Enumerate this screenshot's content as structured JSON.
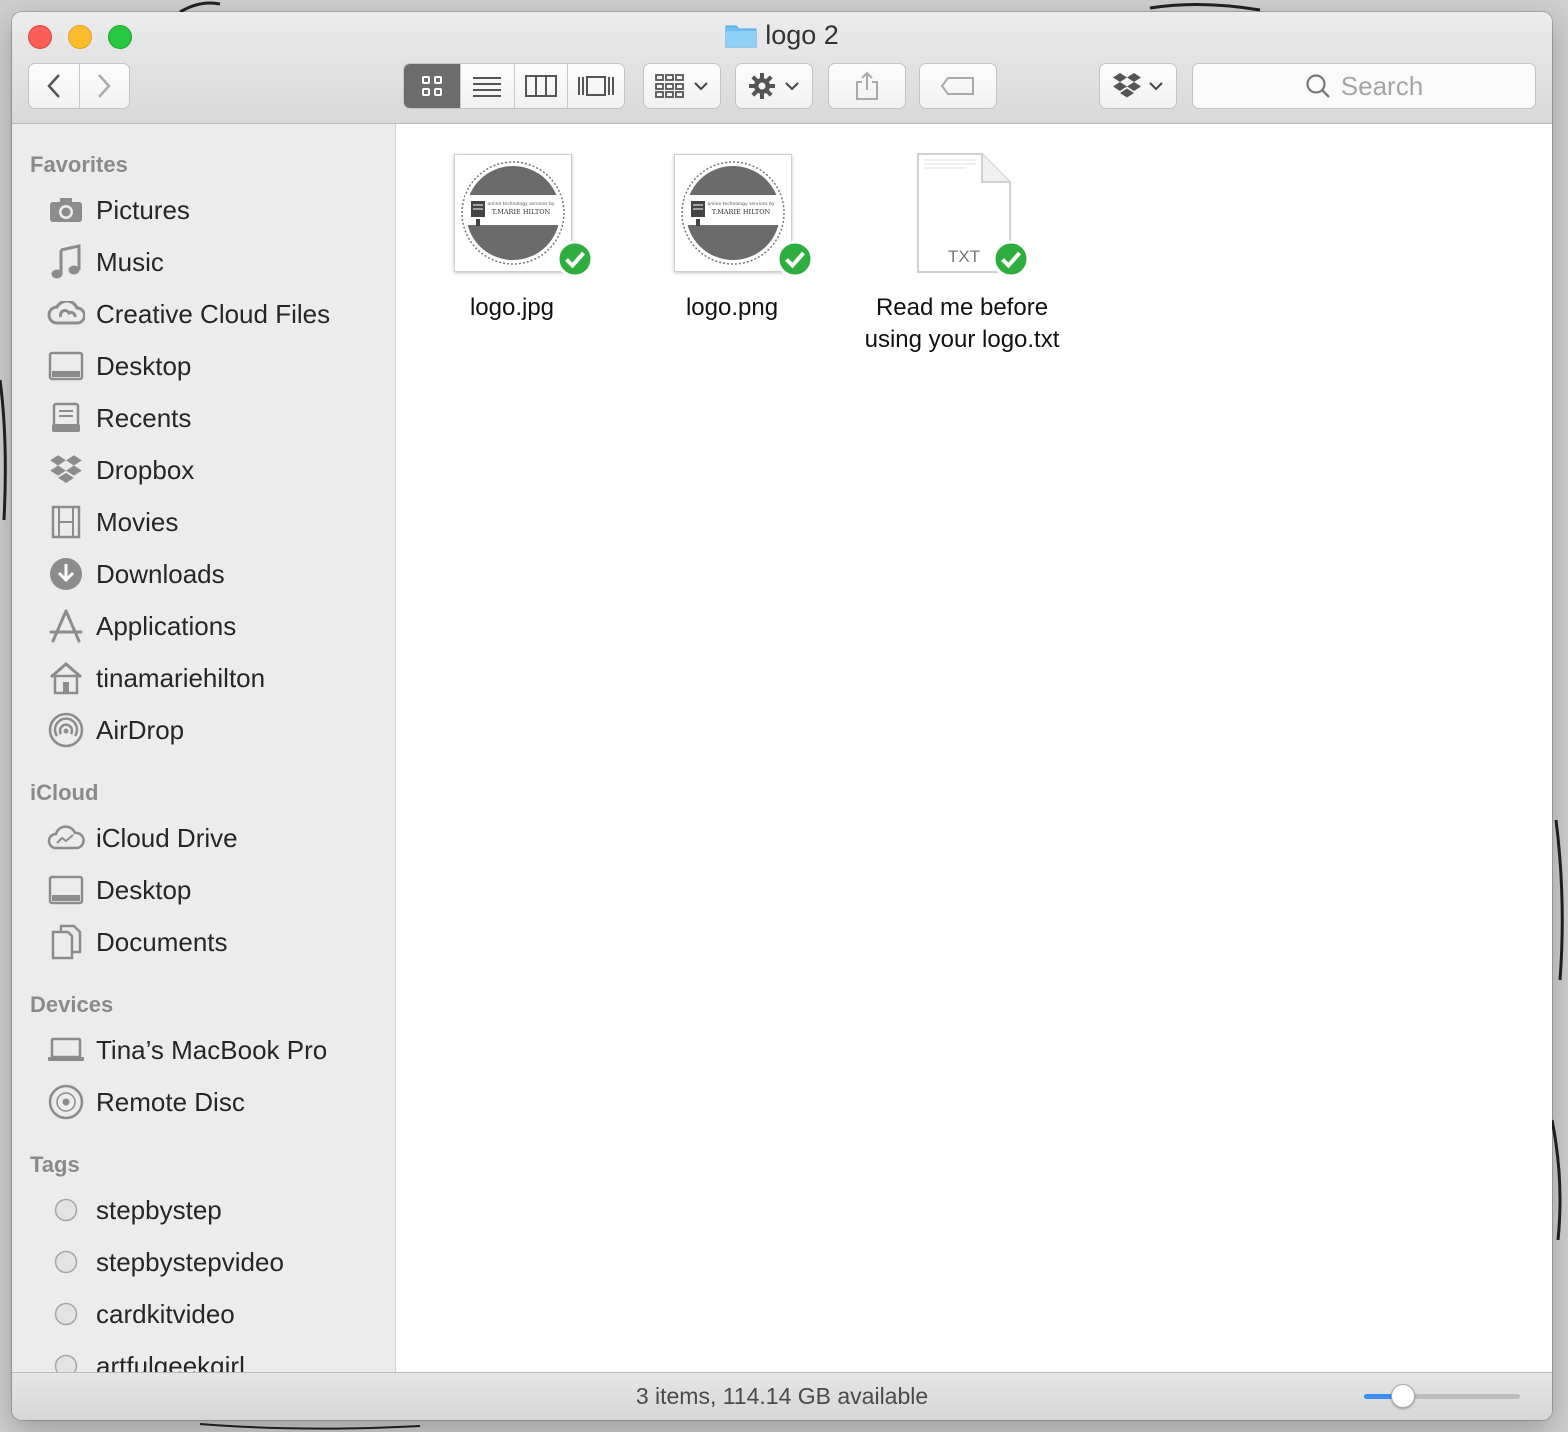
{
  "window": {
    "title": "logo 2"
  },
  "toolbar": {
    "icons": [
      "chevron-left-icon",
      "chevron-right-icon",
      "icon-view-icon",
      "list-view-icon",
      "column-view-icon",
      "cover-flow-icon",
      "arrange-icon",
      "gear-icon",
      "share-icon",
      "tag-icon",
      "dropbox-icon"
    ],
    "search_placeholder": "Search"
  },
  "sidebar": {
    "favorites_header": "Favorites",
    "favorites": [
      {
        "label": "Pictures",
        "icon": "camera-icon"
      },
      {
        "label": "Music",
        "icon": "music-note-icon"
      },
      {
        "label": "Creative Cloud Files",
        "icon": "creative-cloud-icon"
      },
      {
        "label": "Desktop",
        "icon": "desktop-icon"
      },
      {
        "label": "Recents",
        "icon": "recents-icon"
      },
      {
        "label": "Dropbox",
        "icon": "dropbox-icon"
      },
      {
        "label": "Movies",
        "icon": "film-icon"
      },
      {
        "label": "Downloads",
        "icon": "download-icon"
      },
      {
        "label": "Applications",
        "icon": "applications-icon"
      },
      {
        "label": "tinamariehilton",
        "icon": "home-icon"
      },
      {
        "label": "AirDrop",
        "icon": "airdrop-icon"
      }
    ],
    "icloud_header": "iCloud",
    "icloud": [
      {
        "label": "iCloud Drive",
        "icon": "cloud-icon"
      },
      {
        "label": "Desktop",
        "icon": "desktop-icon"
      },
      {
        "label": "Documents",
        "icon": "documents-icon"
      }
    ],
    "devices_header": "Devices",
    "devices": [
      {
        "label": "Tina’s MacBook Pro",
        "icon": "laptop-icon"
      },
      {
        "label": "Remote Disc",
        "icon": "disc-icon"
      }
    ],
    "tags_header": "Tags",
    "tags": [
      {
        "label": "stepbystep"
      },
      {
        "label": "stepbystepvideo"
      },
      {
        "label": "cardkitvideo"
      },
      {
        "label": "artfulgeekgirl"
      }
    ]
  },
  "files": [
    {
      "name": "logo.jpg",
      "kind": "image",
      "synced": true
    },
    {
      "name": "logo.png",
      "kind": "image",
      "synced": true
    },
    {
      "name_line1": "Read me before",
      "name_line2": "using your logo.txt",
      "kind": "text",
      "badge": "TXT",
      "synced": true
    }
  ],
  "thumbnail_logo_text": {
    "tagline": "online technology services by",
    "brand": "T.MARIE HILTON"
  },
  "status": {
    "text": "3 items, 114.14 GB available",
    "icon_size_fraction": 0.25
  },
  "colors": {
    "accent": "#3c8ff7",
    "sync_check": "#2eae3e",
    "close": "#fc5f57",
    "minimize": "#fdbc2e",
    "zoom": "#27c840"
  }
}
